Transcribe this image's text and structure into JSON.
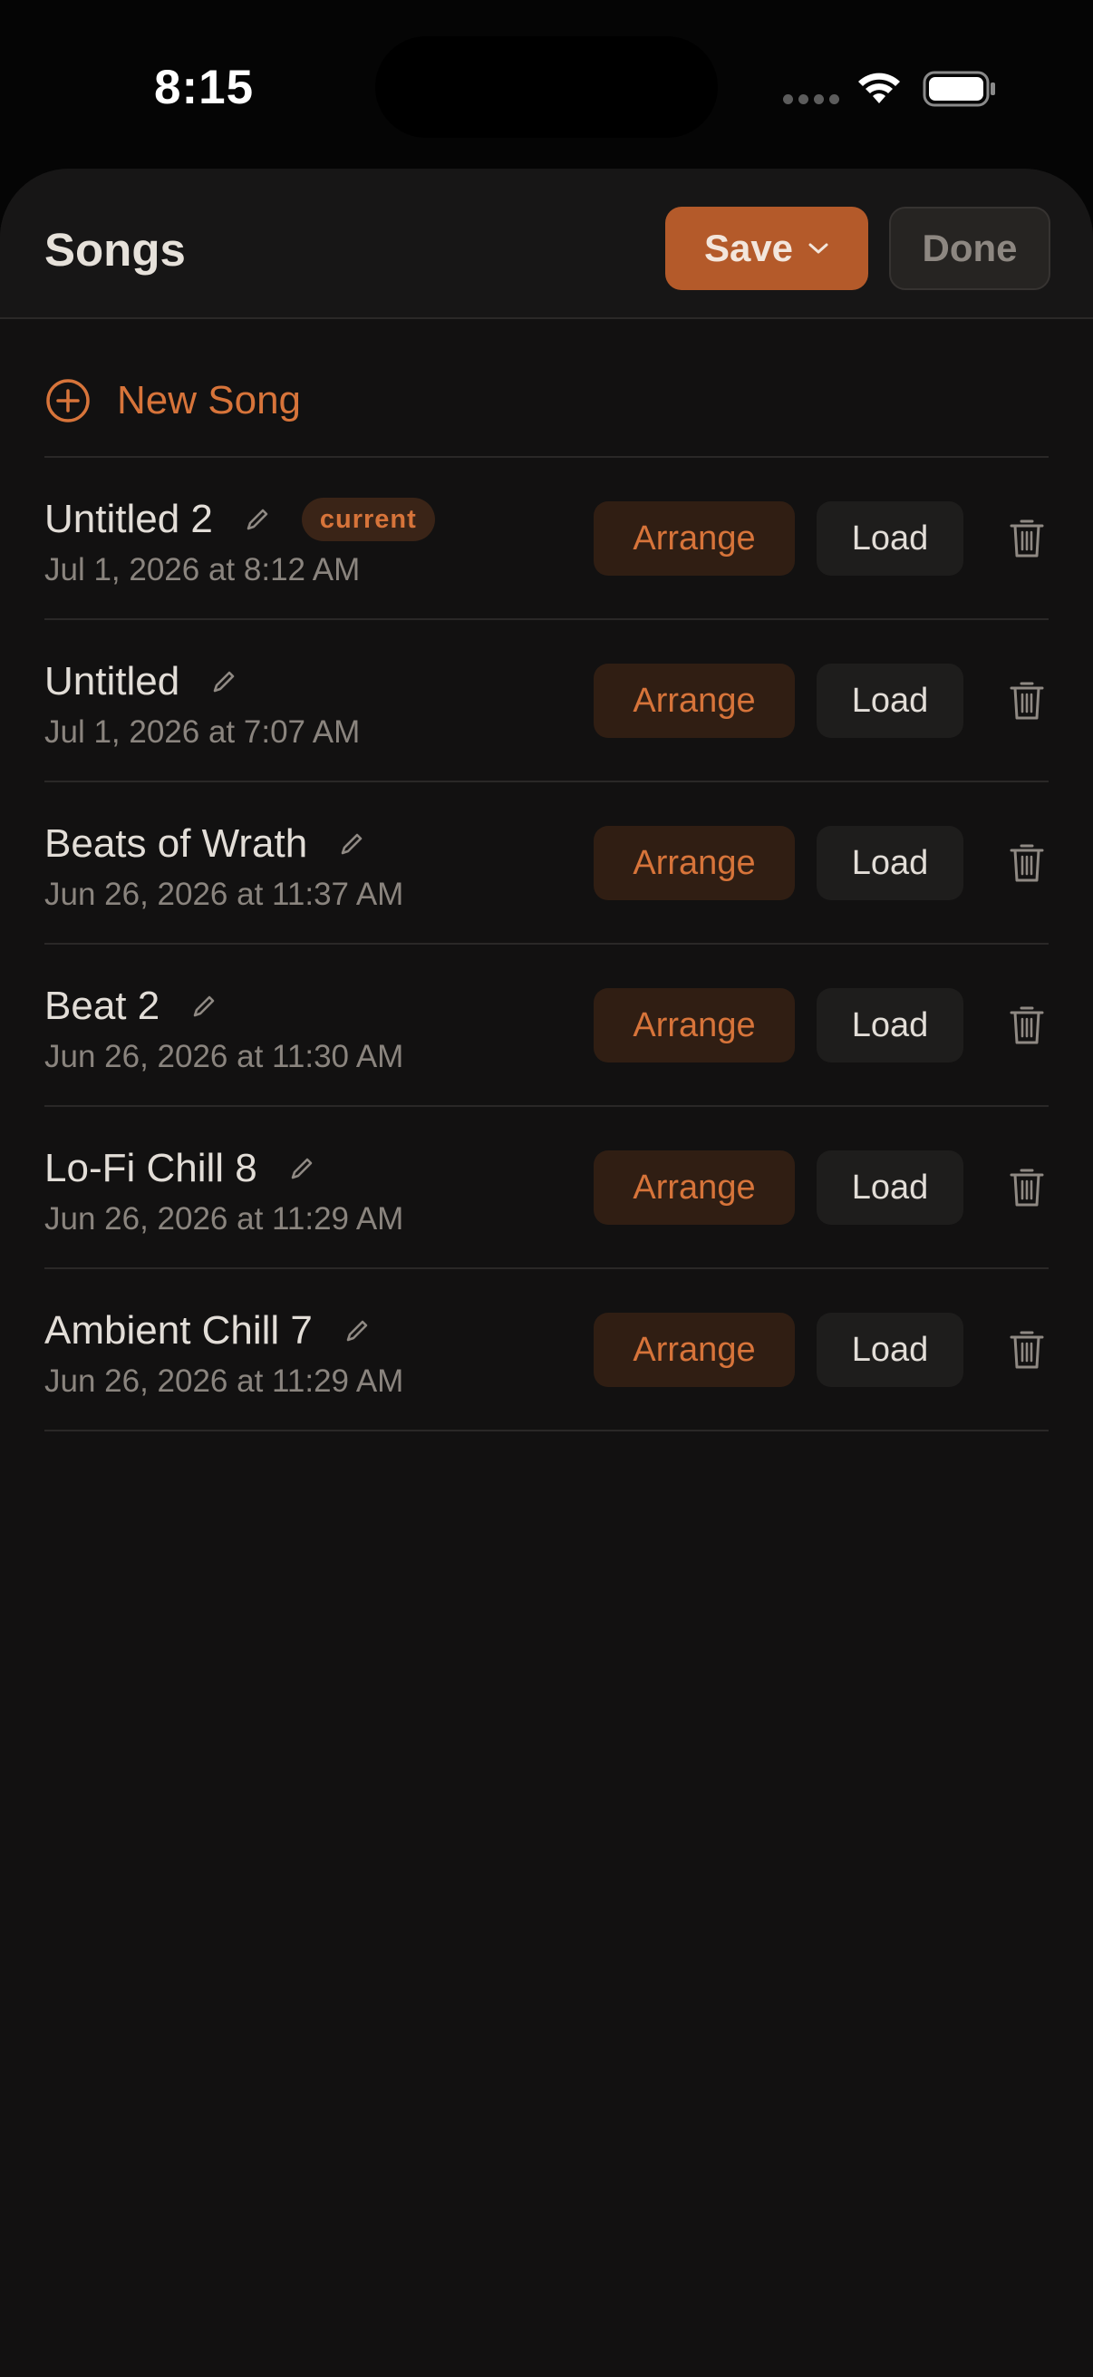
{
  "status_bar": {
    "time": "8:15",
    "icons": [
      "cellular-signal-icon",
      "wifi-icon",
      "battery-icon"
    ]
  },
  "header": {
    "title": "Songs",
    "save_label": "Save",
    "done_label": "Done"
  },
  "new_song": {
    "label": "New Song",
    "icon": "plus-circle-icon"
  },
  "songs": [
    {
      "name": "Untitled 2",
      "date": "Jul 1, 2026 at 8:12 AM",
      "badge": "current",
      "arrange_label": "Arrange",
      "load_label": "Load"
    },
    {
      "name": "Untitled",
      "date": "Jul 1, 2026 at 7:07 AM",
      "badge": null,
      "arrange_label": "Arrange",
      "load_label": "Load"
    },
    {
      "name": "Beats of Wrath",
      "date": "Jun 26, 2026 at 11:37 AM",
      "badge": null,
      "arrange_label": "Arrange",
      "load_label": "Load"
    },
    {
      "name": "Beat 2",
      "date": "Jun 26, 2026 at 11:30 AM",
      "badge": null,
      "arrange_label": "Arrange",
      "load_label": "Load"
    },
    {
      "name": "Lo-Fi Chill 8",
      "date": "Jun 26, 2026 at 11:29 AM",
      "badge": null,
      "arrange_label": "Arrange",
      "load_label": "Load"
    },
    {
      "name": "Ambient Chill 7",
      "date": "Jun 26, 2026 at 11:29 AM",
      "badge": null,
      "arrange_label": "Arrange",
      "load_label": "Load"
    }
  ],
  "colors": {
    "accent": "#d7743a",
    "save_button": "#b45a2a",
    "background": "#121111",
    "text_primary": "#e2ddd7",
    "text_secondary": "#8a847e"
  }
}
